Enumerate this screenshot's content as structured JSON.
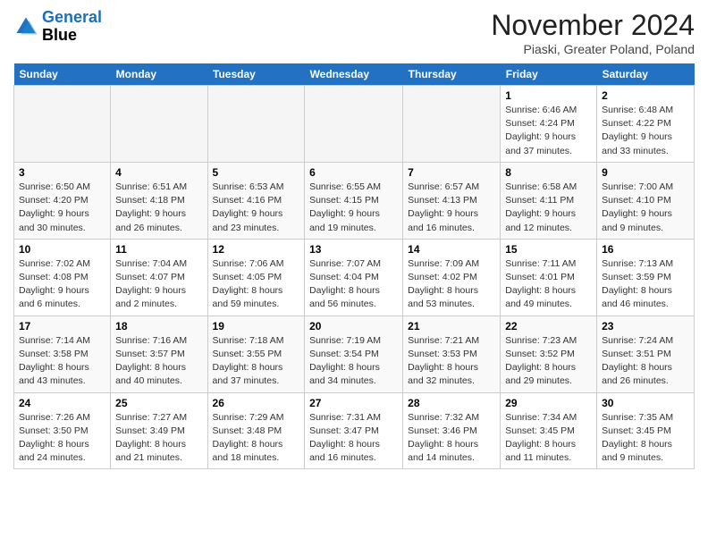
{
  "header": {
    "logo_line1": "General",
    "logo_line2": "Blue",
    "month_title": "November 2024",
    "location": "Piaski, Greater Poland, Poland"
  },
  "columns": [
    "Sunday",
    "Monday",
    "Tuesday",
    "Wednesday",
    "Thursday",
    "Friday",
    "Saturday"
  ],
  "weeks": [
    [
      {
        "day": "",
        "info": ""
      },
      {
        "day": "",
        "info": ""
      },
      {
        "day": "",
        "info": ""
      },
      {
        "day": "",
        "info": ""
      },
      {
        "day": "",
        "info": ""
      },
      {
        "day": "1",
        "info": "Sunrise: 6:46 AM\nSunset: 4:24 PM\nDaylight: 9 hours and 37 minutes."
      },
      {
        "day": "2",
        "info": "Sunrise: 6:48 AM\nSunset: 4:22 PM\nDaylight: 9 hours and 33 minutes."
      }
    ],
    [
      {
        "day": "3",
        "info": "Sunrise: 6:50 AM\nSunset: 4:20 PM\nDaylight: 9 hours and 30 minutes."
      },
      {
        "day": "4",
        "info": "Sunrise: 6:51 AM\nSunset: 4:18 PM\nDaylight: 9 hours and 26 minutes."
      },
      {
        "day": "5",
        "info": "Sunrise: 6:53 AM\nSunset: 4:16 PM\nDaylight: 9 hours and 23 minutes."
      },
      {
        "day": "6",
        "info": "Sunrise: 6:55 AM\nSunset: 4:15 PM\nDaylight: 9 hours and 19 minutes."
      },
      {
        "day": "7",
        "info": "Sunrise: 6:57 AM\nSunset: 4:13 PM\nDaylight: 9 hours and 16 minutes."
      },
      {
        "day": "8",
        "info": "Sunrise: 6:58 AM\nSunset: 4:11 PM\nDaylight: 9 hours and 12 minutes."
      },
      {
        "day": "9",
        "info": "Sunrise: 7:00 AM\nSunset: 4:10 PM\nDaylight: 9 hours and 9 minutes."
      }
    ],
    [
      {
        "day": "10",
        "info": "Sunrise: 7:02 AM\nSunset: 4:08 PM\nDaylight: 9 hours and 6 minutes."
      },
      {
        "day": "11",
        "info": "Sunrise: 7:04 AM\nSunset: 4:07 PM\nDaylight: 9 hours and 2 minutes."
      },
      {
        "day": "12",
        "info": "Sunrise: 7:06 AM\nSunset: 4:05 PM\nDaylight: 8 hours and 59 minutes."
      },
      {
        "day": "13",
        "info": "Sunrise: 7:07 AM\nSunset: 4:04 PM\nDaylight: 8 hours and 56 minutes."
      },
      {
        "day": "14",
        "info": "Sunrise: 7:09 AM\nSunset: 4:02 PM\nDaylight: 8 hours and 53 minutes."
      },
      {
        "day": "15",
        "info": "Sunrise: 7:11 AM\nSunset: 4:01 PM\nDaylight: 8 hours and 49 minutes."
      },
      {
        "day": "16",
        "info": "Sunrise: 7:13 AM\nSunset: 3:59 PM\nDaylight: 8 hours and 46 minutes."
      }
    ],
    [
      {
        "day": "17",
        "info": "Sunrise: 7:14 AM\nSunset: 3:58 PM\nDaylight: 8 hours and 43 minutes."
      },
      {
        "day": "18",
        "info": "Sunrise: 7:16 AM\nSunset: 3:57 PM\nDaylight: 8 hours and 40 minutes."
      },
      {
        "day": "19",
        "info": "Sunrise: 7:18 AM\nSunset: 3:55 PM\nDaylight: 8 hours and 37 minutes."
      },
      {
        "day": "20",
        "info": "Sunrise: 7:19 AM\nSunset: 3:54 PM\nDaylight: 8 hours and 34 minutes."
      },
      {
        "day": "21",
        "info": "Sunrise: 7:21 AM\nSunset: 3:53 PM\nDaylight: 8 hours and 32 minutes."
      },
      {
        "day": "22",
        "info": "Sunrise: 7:23 AM\nSunset: 3:52 PM\nDaylight: 8 hours and 29 minutes."
      },
      {
        "day": "23",
        "info": "Sunrise: 7:24 AM\nSunset: 3:51 PM\nDaylight: 8 hours and 26 minutes."
      }
    ],
    [
      {
        "day": "24",
        "info": "Sunrise: 7:26 AM\nSunset: 3:50 PM\nDaylight: 8 hours and 24 minutes."
      },
      {
        "day": "25",
        "info": "Sunrise: 7:27 AM\nSunset: 3:49 PM\nDaylight: 8 hours and 21 minutes."
      },
      {
        "day": "26",
        "info": "Sunrise: 7:29 AM\nSunset: 3:48 PM\nDaylight: 8 hours and 18 minutes."
      },
      {
        "day": "27",
        "info": "Sunrise: 7:31 AM\nSunset: 3:47 PM\nDaylight: 8 hours and 16 minutes."
      },
      {
        "day": "28",
        "info": "Sunrise: 7:32 AM\nSunset: 3:46 PM\nDaylight: 8 hours and 14 minutes."
      },
      {
        "day": "29",
        "info": "Sunrise: 7:34 AM\nSunset: 3:45 PM\nDaylight: 8 hours and 11 minutes."
      },
      {
        "day": "30",
        "info": "Sunrise: 7:35 AM\nSunset: 3:45 PM\nDaylight: 8 hours and 9 minutes."
      }
    ]
  ]
}
